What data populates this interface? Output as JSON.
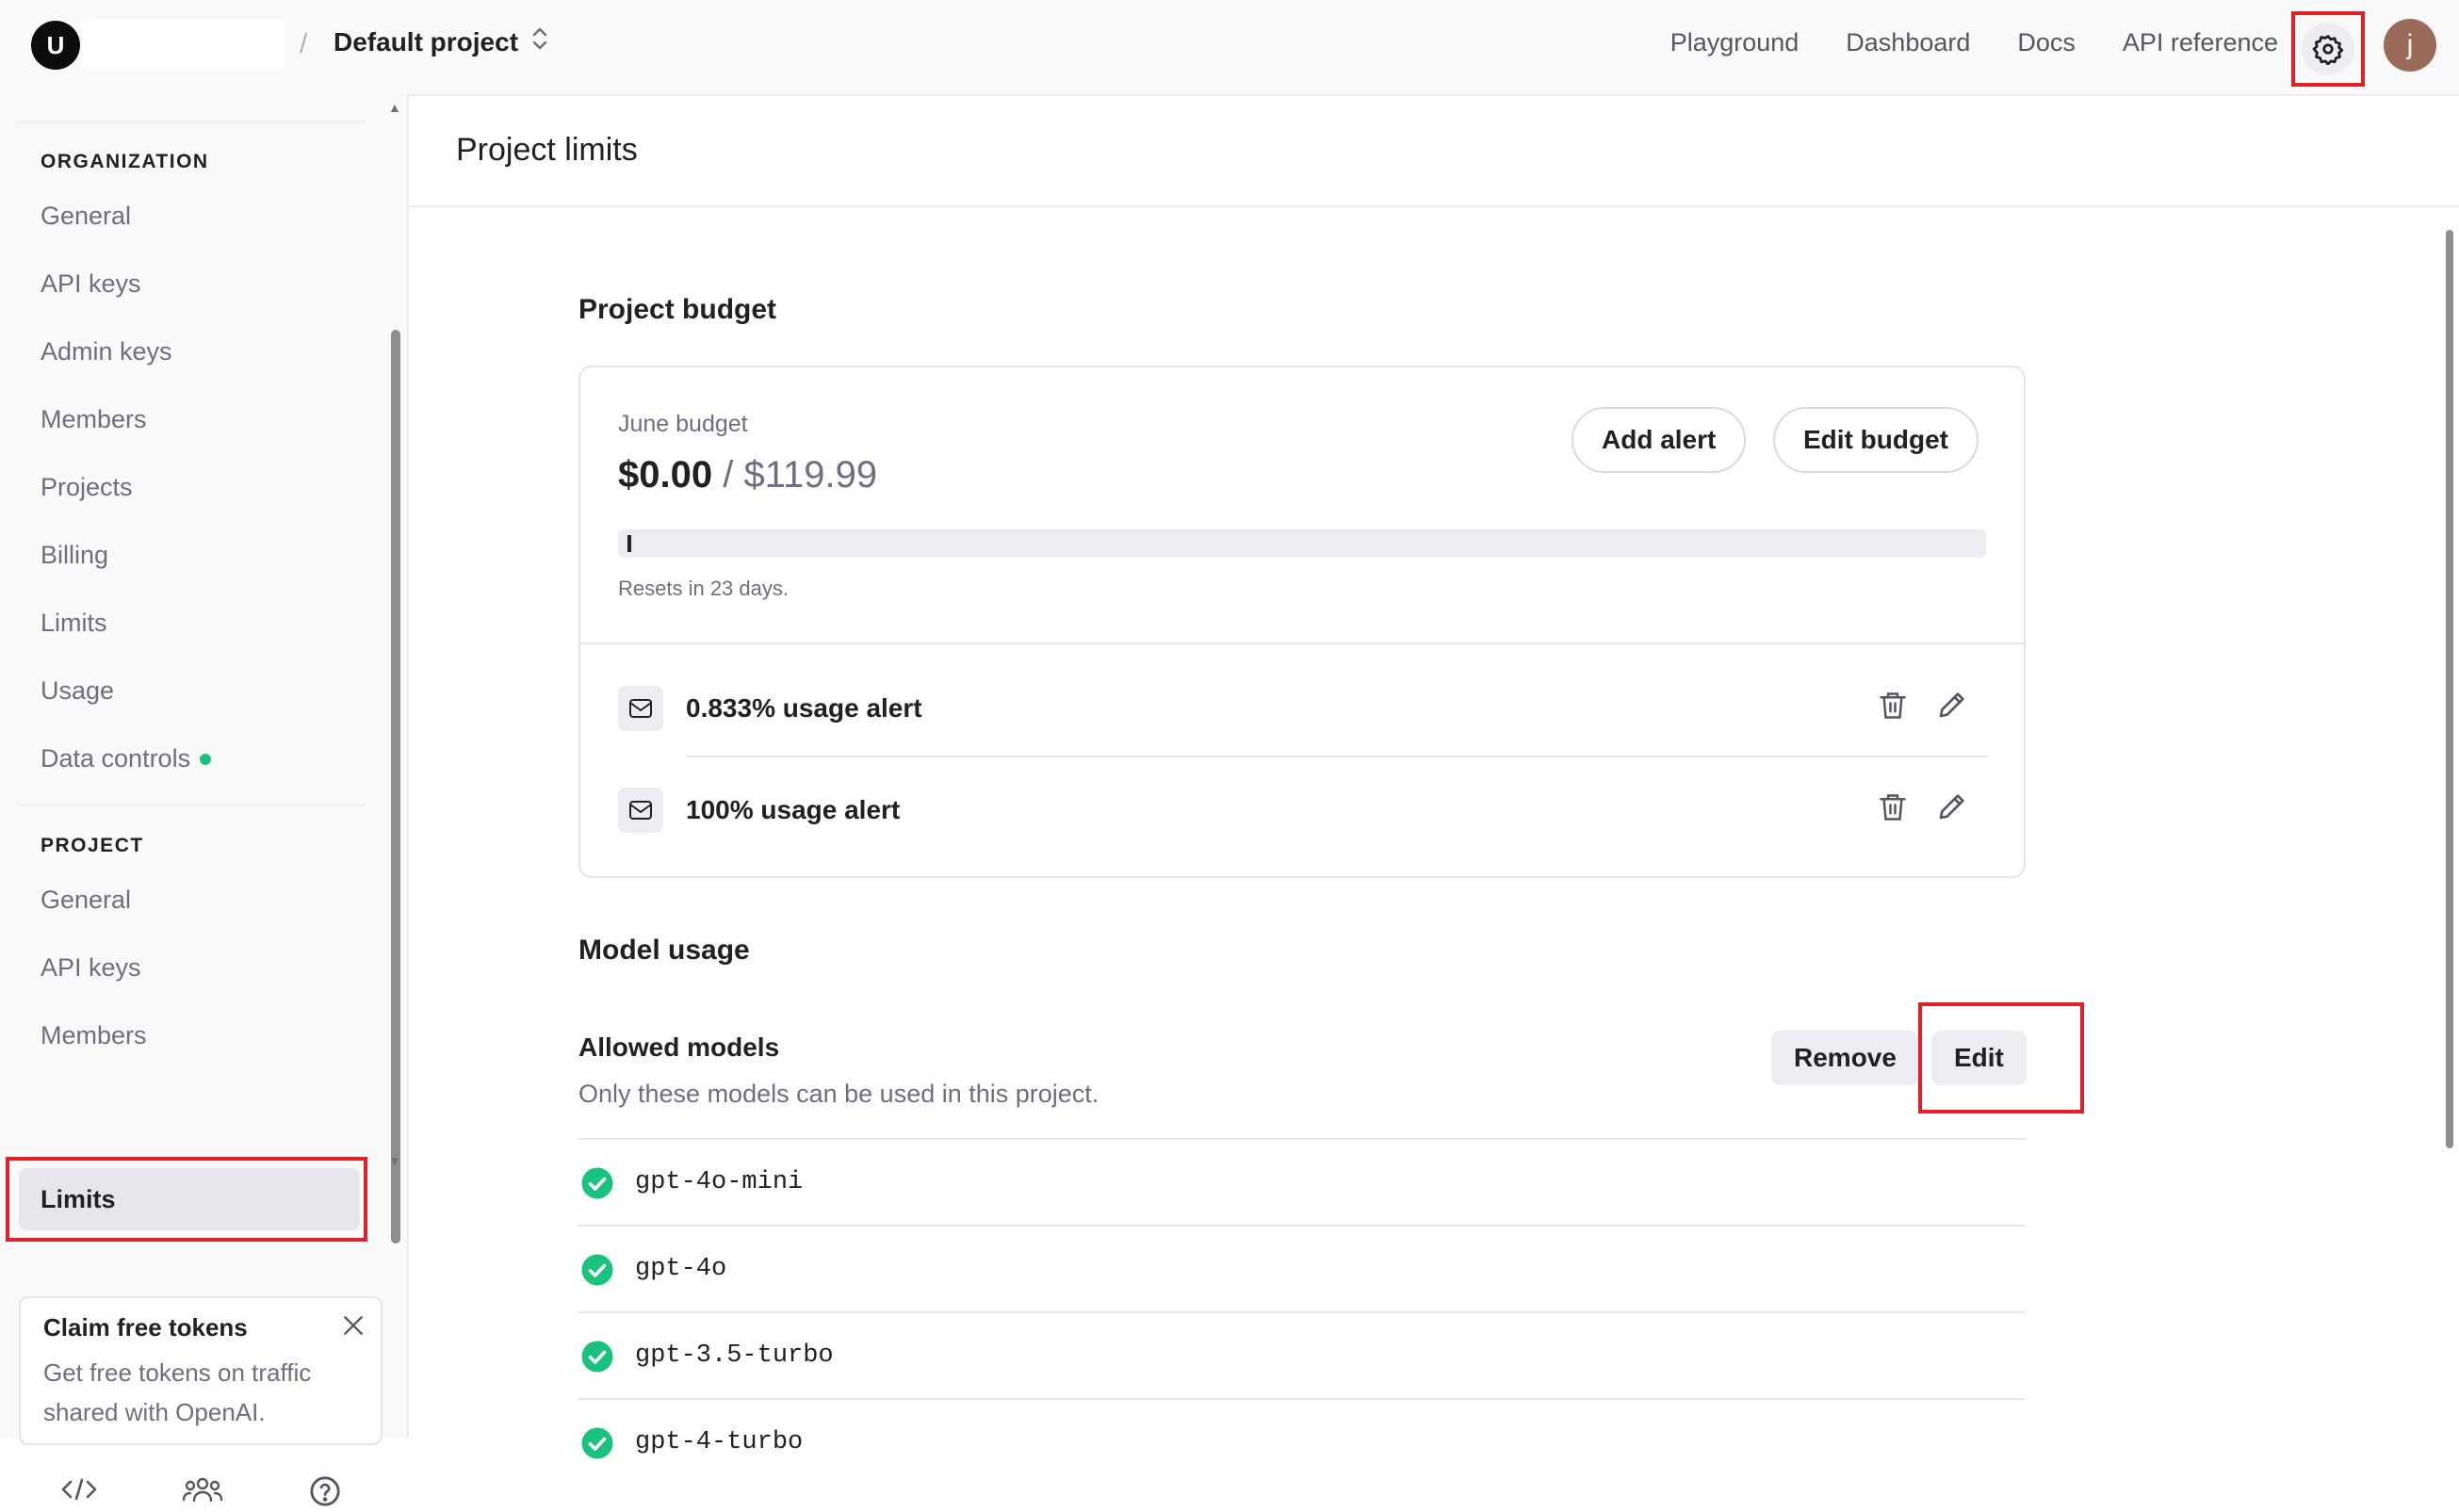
{
  "header": {
    "org_initial": "U",
    "separator": "/",
    "project_name": "Default project",
    "nav": [
      "Playground",
      "Dashboard",
      "Docs",
      "API reference"
    ],
    "user_initial": "j",
    "settings_icon": "gear-icon"
  },
  "sidebar": {
    "org_heading": "ORGANIZATION",
    "org_items": [
      "General",
      "API keys",
      "Admin keys",
      "Members",
      "Projects",
      "Billing",
      "Limits",
      "Usage",
      "Data controls"
    ],
    "project_heading": "PROJECT",
    "project_items": [
      "General",
      "API keys",
      "Members"
    ],
    "active_item": "Limits",
    "promo": {
      "title": "Claim free tokens",
      "text": "Get free tokens on traffic shared with OpenAI."
    },
    "bottom_icons": [
      "code-icon",
      "team-icon",
      "help-icon"
    ]
  },
  "main": {
    "page_title": "Project limits",
    "budget": {
      "section_title": "Project budget",
      "label": "June budget",
      "spent": "$0.00",
      "separator": "/",
      "limit": "$119.99",
      "spent_fraction": 0,
      "add_alert_label": "Add alert",
      "edit_budget_label": "Edit budget",
      "reset_text": "Resets in 23 days.",
      "alerts": [
        "0.833% usage alert",
        "100% usage alert"
      ]
    },
    "model_usage": {
      "section_title": "Model usage",
      "allowed_title": "Allowed models",
      "allowed_desc": "Only these models can be used in this project.",
      "remove_label": "Remove",
      "edit_label": "Edit",
      "models": [
        "gpt-4o-mini",
        "gpt-4o",
        "gpt-3.5-turbo",
        "gpt-4-turbo"
      ]
    }
  },
  "colors": {
    "accent_green": "#19c37d",
    "highlight_red": "#e0202a"
  }
}
